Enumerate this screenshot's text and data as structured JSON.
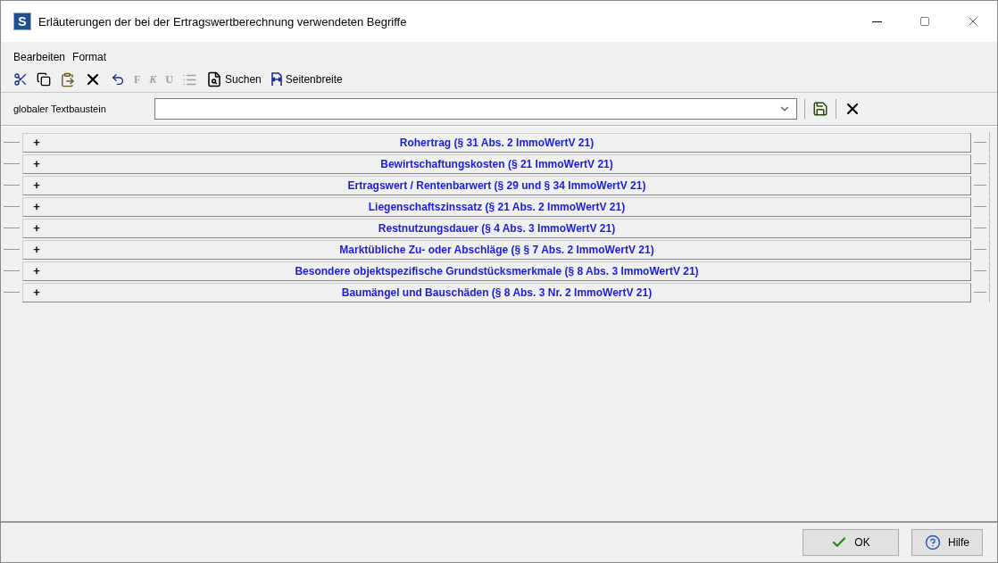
{
  "window": {
    "title": "Erläuterungen der bei der Ertragswertberechnung verwendeten Begriffe",
    "app_letter": "S"
  },
  "menu": [
    "Bearbeiten",
    "Format"
  ],
  "toolbar": [
    {
      "kind": "icon",
      "disabled": false
    },
    {
      "kind": "icon",
      "disabled": false
    },
    {
      "kind": "icon",
      "disabled": false
    },
    {
      "kind": "icon",
      "disabled": false
    },
    {
      "kind": "icon",
      "disabled": false
    },
    {
      "kind": "letter",
      "label": "F",
      "disabled": true
    },
    {
      "kind": "letter",
      "label": "K",
      "disabled": true
    },
    {
      "kind": "letter",
      "label": "U",
      "disabled": true
    },
    {
      "kind": "icon",
      "disabled": true
    },
    {
      "kind": "text",
      "label": "Suchen",
      "disabled": false
    },
    {
      "kind": "text",
      "label": "Seitenbreite",
      "disabled": false
    }
  ],
  "textbaustein": {
    "label": "globaler Textbaustein"
  },
  "sections": [
    {
      "label": "Rohertrag (§ 31 Abs. 2 ImmoWertV 21)",
      "toggle": "+",
      "expanded": false
    },
    {
      "label": "Bewirtschaftungskosten (§ 21 ImmoWertV 21)",
      "toggle": "+",
      "expanded": false
    },
    {
      "label": "Ertragswert / Rentenbarwert (§ 29 und § 34 ImmoWertV 21)",
      "toggle": "+",
      "expanded": false
    },
    {
      "label": "Liegenschaftszinssatz (§ 21 Abs. 2 ImmoWertV 21)",
      "toggle": "+",
      "expanded": false
    },
    {
      "label": "Restnutzungsdauer (§ 4 Abs. 3 ImmoWertV 21)",
      "toggle": "+",
      "expanded": false
    },
    {
      "label": "Marktübliche Zu- oder Abschläge (§  § 7 Abs. 2 ImmoWertV 21)",
      "toggle": "+",
      "expanded": false
    },
    {
      "label": "Besondere objektspezifische Grundstücksmerkmale (§ 8 Abs. 3 ImmoWertV 21)",
      "toggle": "+",
      "expanded": false
    },
    {
      "label": "Baumängel und Bauschäden (§ 8 Abs. 3 Nr. 2 ImmoWertV 21)",
      "toggle": "+",
      "expanded": false
    }
  ],
  "buttons": [
    {
      "kind": "ok",
      "label": "OK"
    },
    {
      "kind": "help",
      "label": "Hilfe"
    }
  ]
}
